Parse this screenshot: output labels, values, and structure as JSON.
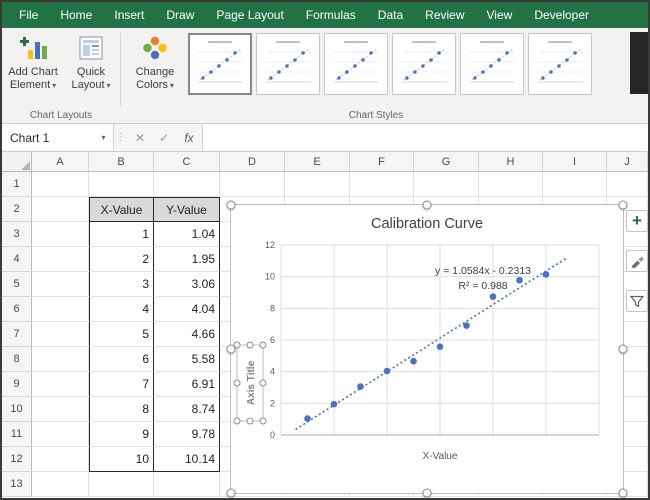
{
  "tabs": [
    "File",
    "Home",
    "Insert",
    "Draw",
    "Page Layout",
    "Formulas",
    "Data",
    "Review",
    "View",
    "Developer"
  ],
  "glyphs": {
    "caret": "▾",
    "dots": "⋮",
    "cancel": "✕",
    "enter": "✓",
    "plus": "+"
  },
  "ribbon": {
    "add_chart_element": [
      "Add Chart",
      "Element"
    ],
    "quick_layout": [
      "Quick",
      "Layout"
    ],
    "change_colors": [
      "Change",
      "Colors"
    ],
    "groups": {
      "chart_layouts": "Chart Layouts",
      "chart_styles": "Chart Styles"
    },
    "style_thumbnail_count": 6
  },
  "formula_bar": {
    "name_box": "Chart 1",
    "fx": "fx",
    "value": ""
  },
  "sheet": {
    "columns": [
      "A",
      "B",
      "C",
      "D",
      "E",
      "F",
      "G",
      "H",
      "I",
      "J"
    ],
    "rows": [
      "1",
      "2",
      "3",
      "4",
      "5",
      "6",
      "7",
      "8",
      "9",
      "10",
      "11",
      "12",
      "13"
    ],
    "table": {
      "origin": {
        "col": "B",
        "row": 2
      },
      "headers": [
        "X-Value",
        "Y-Value"
      ],
      "rows": [
        [
          "1",
          "1.04"
        ],
        [
          "2",
          "1.95"
        ],
        [
          "3",
          "3.06"
        ],
        [
          "4",
          "4.04"
        ],
        [
          "5",
          "4.66"
        ],
        [
          "6",
          "5.58"
        ],
        [
          "7",
          "6.91"
        ],
        [
          "8",
          "8.74"
        ],
        [
          "9",
          "9.78"
        ],
        [
          "10",
          "10.14"
        ]
      ]
    }
  },
  "chart_data": {
    "type": "scatter",
    "title": "Calibration Curve",
    "x": [
      1,
      2,
      3,
      4,
      5,
      6,
      7,
      8,
      9,
      10
    ],
    "y": [
      1.04,
      1.95,
      3.06,
      4.04,
      4.66,
      5.58,
      6.91,
      8.74,
      9.78,
      10.14
    ],
    "xlim": [
      0,
      12
    ],
    "ylim": [
      0,
      12
    ],
    "yticks": [
      0,
      2,
      4,
      6,
      8,
      10,
      12
    ],
    "xgrid_step": 2,
    "xlabel": "X-Value",
    "y_axis_title": "Axis Title",
    "trendline": {
      "slope": 1.0584,
      "intercept": -0.2313,
      "equation": "y = 1.0584x - 0.2313",
      "r_squared": "R² = 0.988",
      "style": "dotted"
    },
    "point_color": "#4472c4",
    "grid": true,
    "legend": false
  },
  "side_buttons": [
    {
      "name": "chart-elements-button",
      "icon": "plus-icon"
    },
    {
      "name": "chart-styles-button",
      "icon": "brush-icon"
    },
    {
      "name": "chart-filters-button",
      "icon": "funnel-icon"
    }
  ]
}
